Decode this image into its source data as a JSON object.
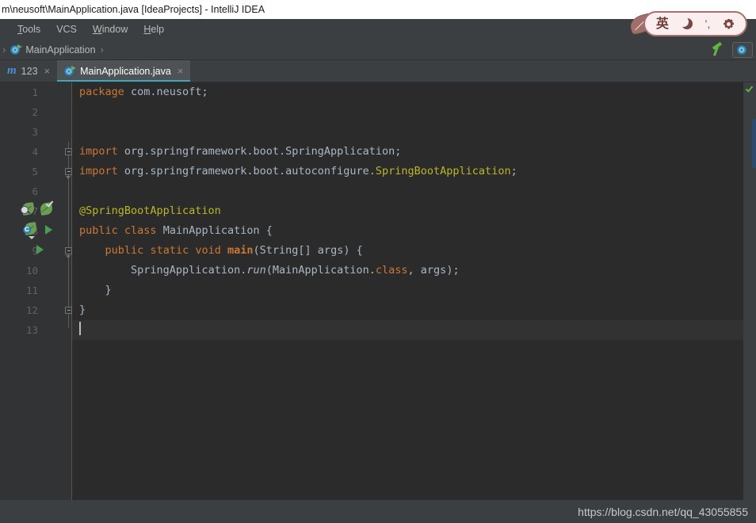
{
  "window": {
    "title": "m\\neusoft\\MainApplication.java [IdeaProjects] - IntelliJ IDEA"
  },
  "menubar": {
    "items": [
      {
        "name": "tools",
        "pre": "T",
        "rest": "ools"
      },
      {
        "name": "vcs",
        "pre": "VCS",
        "rest": ""
      },
      {
        "name": "window",
        "pre": "W",
        "rest": "indow"
      },
      {
        "name": "help",
        "pre": "H",
        "rest": "elp"
      }
    ]
  },
  "navbar": {
    "separator": "›",
    "crumb_label": "MainApplication",
    "build_icon": "hammer-icon"
  },
  "tabs": [
    {
      "label": "123",
      "icon": "maven-icon",
      "close": "×",
      "active": false
    },
    {
      "label": "MainApplication.java",
      "icon": "spring-class-icon",
      "close": "×",
      "active": true
    }
  ],
  "editor": {
    "lines": [
      {
        "no": "1",
        "current": false
      },
      {
        "no": "2",
        "current": false
      },
      {
        "no": "3",
        "current": false
      },
      {
        "no": "4",
        "current": false
      },
      {
        "no": "5",
        "current": false
      },
      {
        "no": "6",
        "current": false
      },
      {
        "no": "7",
        "current": false
      },
      {
        "no": "8",
        "current": false
      },
      {
        "no": "9",
        "current": false
      },
      {
        "no": "10",
        "current": false
      },
      {
        "no": "11",
        "current": false
      },
      {
        "no": "12",
        "current": false
      },
      {
        "no": "13",
        "current": true
      }
    ],
    "code": {
      "l1_kw": "package",
      "l1_rest": " com.neusoft;",
      "l4_kw": "import",
      "l4_rest": " org.springframework.boot.SpringApplication;",
      "l5_kw": "import",
      "l5_mid": " org.springframework.boot.autoconfigure.",
      "l5_ann": "SpringBootApplication",
      "l5_end": ";",
      "l7_ann": "@SpringBootApplication",
      "l8_kw1": "public",
      "l8_kw2": "class",
      "l8_name": "MainApplication",
      "l8_brace": "{",
      "l9_kw1": "public",
      "l9_kw2": "static",
      "l9_kw3": "void",
      "l9_method": "main",
      "l9_params": "(String[] args) {",
      "l10_cls": "SpringApplication.",
      "l10_run": "run",
      "l10_arg1": "(MainApplication.",
      "l10_kw": "class",
      "l10_arg2": ", args);",
      "l11_brace": "}",
      "l12_brace": "}"
    },
    "gutter_icons": [
      {
        "name": "spring-bean-search-icon",
        "line": 7
      },
      {
        "name": "spring-bean-check-icon",
        "line": 7
      },
      {
        "name": "spring-config-bean-icon",
        "line": 8
      },
      {
        "name": "run-class-icon",
        "line": 8
      },
      {
        "name": "run-method-icon",
        "line": 9
      }
    ],
    "fold_markers": [
      4,
      5,
      9,
      11
    ],
    "inspection_status": "no-errors-check-icon"
  },
  "status": {
    "watermark": "https://blog.csdn.net/qq_43055855"
  },
  "ime": {
    "mode_label": "英",
    "moon_icon": "moon-icon",
    "punctuation_label": "’,",
    "gear_icon": "gear-icon"
  },
  "colors": {
    "keyword": "#cc7832",
    "annotation": "#bbb529",
    "identifier": "#a9b7c6",
    "editor_bg": "#2b2b2b",
    "gutter_bg": "#313335",
    "chrome_bg": "#3c3f41",
    "tab_accent": "#3ba7b8",
    "run_green": "#499c54"
  }
}
